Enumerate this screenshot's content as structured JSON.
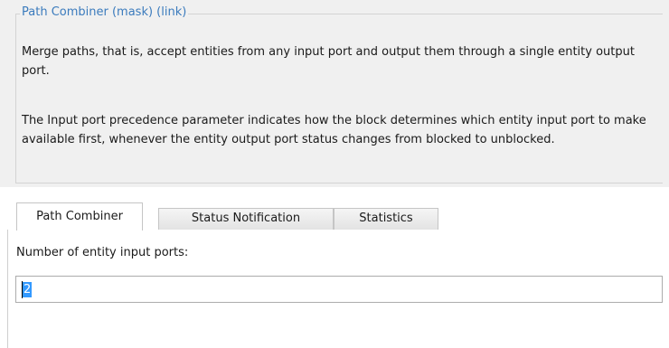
{
  "group": {
    "legend": "Path Combiner (mask) (link)",
    "description_1": "Merge paths, that is, accept entities from any input port and output them through a single entity output port.",
    "description_2": "The Input port precedence parameter indicates how the block determines which entity input port to make available first, whenever the entity output port status changes from blocked to unblocked."
  },
  "tabs": [
    {
      "label": "Path Combiner",
      "active": true
    },
    {
      "label": "Status Notification",
      "active": false
    },
    {
      "label": "Statistics",
      "active": false
    }
  ],
  "parameters": {
    "ports_label": "Number of entity input ports:",
    "ports_value": "2"
  }
}
